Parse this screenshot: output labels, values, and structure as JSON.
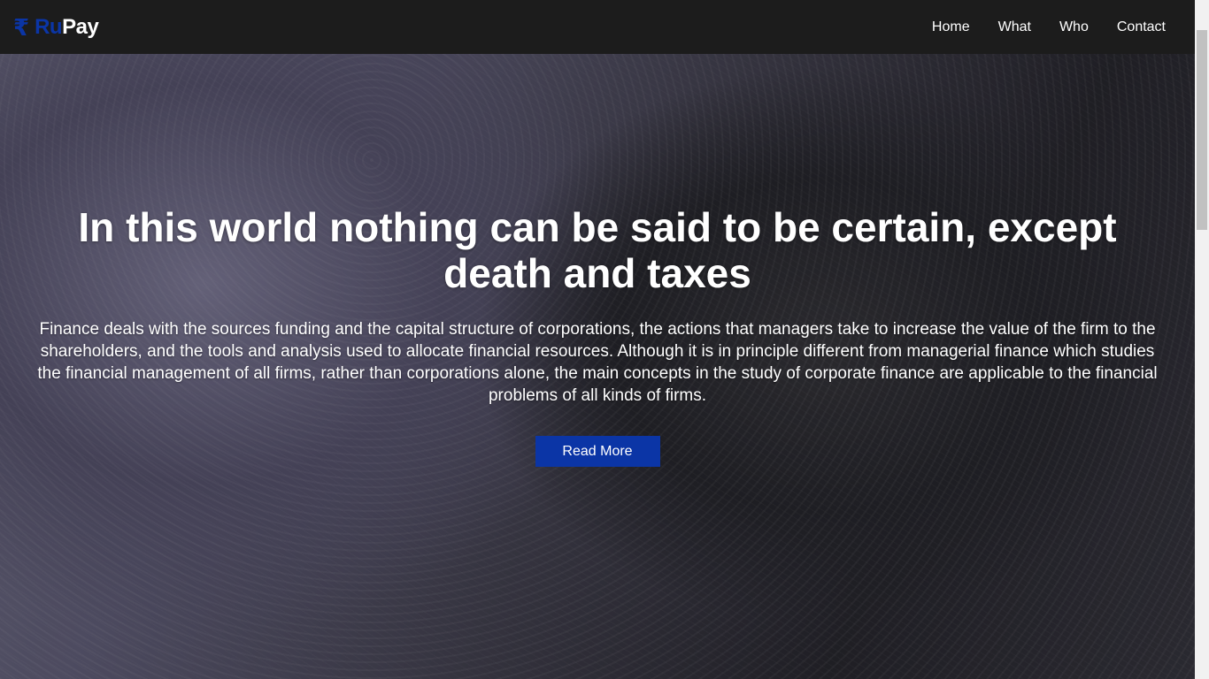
{
  "brand": {
    "icon": "₹",
    "ru": "Ru",
    "pay": "Pay"
  },
  "nav": [
    {
      "label": "Home"
    },
    {
      "label": "What"
    },
    {
      "label": "Who"
    },
    {
      "label": "Contact"
    }
  ],
  "hero": {
    "title": "In this world nothing can be said to be certain, except death and taxes",
    "text": "Finance deals with the sources funding and the capital structure of corporations, the actions that managers take to increase the value of the firm to the shareholders, and the tools and analysis used to allocate financial resources. Although it is in principle different from managerial finance which studies the financial management of all firms, rather than corporations alone, the main concepts in the study of corporate finance are applicable to the financial problems of all kinds of firms.",
    "button": "Read More"
  },
  "colors": {
    "accent": "#0b35a6",
    "navbar": "#1c1c1c"
  }
}
